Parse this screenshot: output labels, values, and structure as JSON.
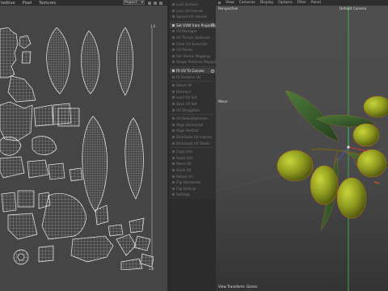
{
  "uv_editor": {
    "menus": [
      "tedtive",
      "Pixel",
      "Textures"
    ],
    "projection_dropdown": "Project",
    "coord_labels": [
      "1.0",
      "0.0",
      "1.0"
    ]
  },
  "tool_menu": {
    "items": [
      {
        "label": "Lock Surface"
      },
      {
        "label": "Lock UV Islands"
      },
      {
        "label": "Spread UV Islands"
      },
      {
        "label": "Set UVW from Projection",
        "active": true
      },
      {
        "label": "UV Manager"
      },
      {
        "label": "UV Terrain Optimize"
      },
      {
        "label": "Clear UV Selection"
      },
      {
        "label": "UV Packer"
      },
      {
        "label": "Set Terrain Mapping"
      },
      {
        "label": "Shape Preserve Mapping"
      },
      {
        "label": "Fit UV To Canvas",
        "active": true
      },
      {
        "label": "Fit Relation UV"
      },
      {
        "label": "Select All"
      },
      {
        "label": "Deselect"
      },
      {
        "label": "Load UV Set"
      },
      {
        "label": "Save UV Set"
      },
      {
        "label": "UV Straighten"
      },
      {
        "label": "UV Relax/Optimize"
      },
      {
        "label": "Align Horizontal"
      },
      {
        "label": "Align Vertical"
      },
      {
        "label": "Distribute UV Islands"
      },
      {
        "label": "Distribute UV Shells"
      },
      {
        "label": "Copy UVs"
      },
      {
        "label": "Paste UVs"
      },
      {
        "label": "Move UV"
      },
      {
        "label": "Scale UV"
      },
      {
        "label": "Rotate UV"
      },
      {
        "label": "Flip Horizontal"
      },
      {
        "label": "Flip Vertical"
      },
      {
        "label": "Settings"
      }
    ]
  },
  "viewport": {
    "menus": [
      "View",
      "Cameras",
      "Display",
      "Options",
      "Filter",
      "Panel"
    ],
    "projection_label": "Perspective",
    "camera_label": "Default Camera",
    "move_label": "Move",
    "bottom_label": "View Transform: Gizmo"
  },
  "colors": {
    "uv_background": "#454545",
    "uv_lines": "#e8e8e8",
    "olive_fill": "#8a9a1c",
    "leaf_fill": "#2f5a2a",
    "viewport_bg": "#4b4b4b",
    "axis_green": "#3fbf55"
  }
}
